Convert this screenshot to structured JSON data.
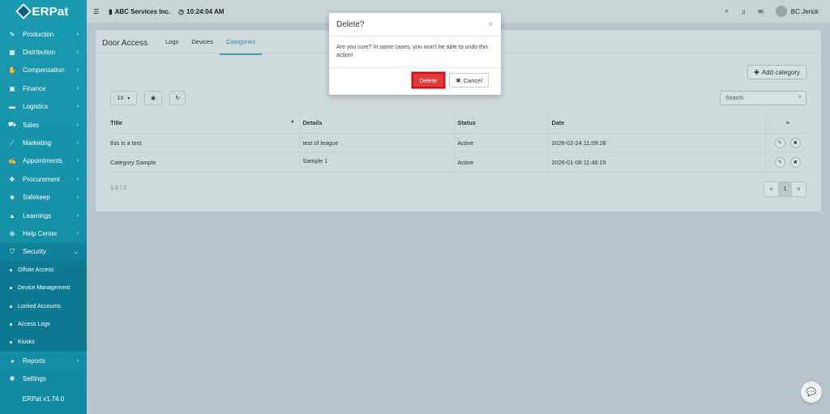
{
  "app": {
    "logo": "ERPat",
    "version": "ERPat v1.74.0"
  },
  "topbar": {
    "company": "ABC Services Inc.",
    "time": "10:24:04 AM",
    "user": "BC Jerick"
  },
  "sidebar": {
    "items": [
      {
        "label": "Production",
        "icon": "pen-icon"
      },
      {
        "label": "Distribution",
        "icon": "warehouse-icon"
      },
      {
        "label": "Compensation",
        "icon": "hand-coin-icon"
      },
      {
        "label": "Finance",
        "icon": "money-icon"
      },
      {
        "label": "Logistics",
        "icon": "truck-icon"
      },
      {
        "label": "Sales",
        "icon": "cart-icon"
      },
      {
        "label": "Marketing",
        "icon": "chart-icon"
      },
      {
        "label": "Appointments",
        "icon": "edit-icon"
      },
      {
        "label": "Procurement",
        "icon": "handshake-icon"
      },
      {
        "label": "Safekeep",
        "icon": "box-icon"
      },
      {
        "label": "Learnings",
        "icon": "graduation-icon"
      },
      {
        "label": "Help Center",
        "icon": "lifebuoy-icon"
      },
      {
        "label": "Security",
        "icon": "shield-icon"
      }
    ],
    "security_sub": [
      "Offsite Access",
      "Device Management",
      "Locked Accounts",
      "Access Logs",
      "Kiosks"
    ],
    "bottom_items": [
      {
        "label": "Reports",
        "icon": "pie-icon"
      },
      {
        "label": "Settings",
        "icon": "wrench-icon"
      }
    ]
  },
  "page": {
    "title": "Door Access",
    "tabs": [
      "Logs",
      "Devices",
      "Categories"
    ],
    "add_label": "Add category",
    "page_size": "10",
    "search_placeholder": "Search",
    "columns": [
      "Title",
      "Details",
      "Status",
      "Date"
    ],
    "rows": [
      {
        "title": "this is a test",
        "details": "test of league",
        "status": "Active",
        "date": "2026-02-24 11:09:28"
      },
      {
        "title": "Category Sample",
        "details": "Sample 1",
        "status": "Active",
        "date": "2026-01-08 11:46:15"
      }
    ],
    "pager_info": "1-2 / 2",
    "pager": {
      "prev": "«",
      "current": "1",
      "next": "»"
    }
  },
  "modal": {
    "title": "Delete?",
    "body": "Are you sure? In some cases, you won't be able to undo this action!",
    "delete_label": "Delete",
    "cancel_label": "Cancel"
  }
}
